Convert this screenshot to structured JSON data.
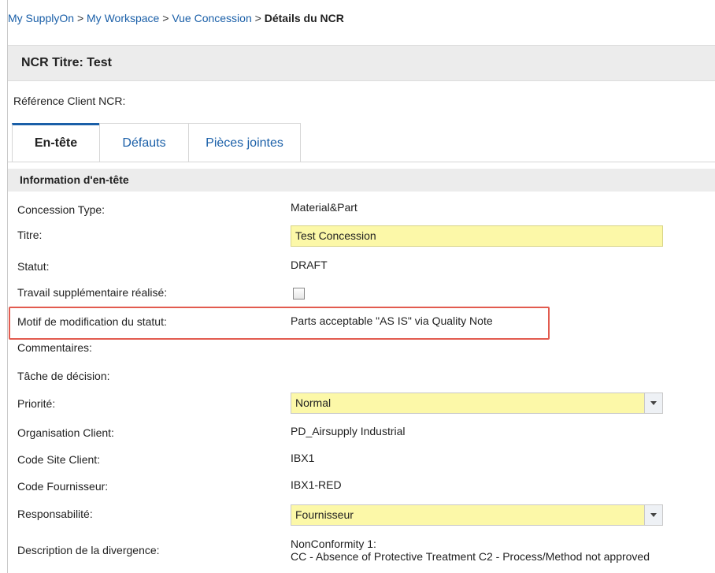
{
  "breadcrumb": {
    "items": [
      "My SupplyOn",
      "My Workspace",
      "Vue Concession"
    ],
    "separator": ">",
    "current": "Détails du NCR"
  },
  "ncr_title": "NCR Titre: Test",
  "reference_label": "Référence Client NCR:",
  "tabs": [
    {
      "label": "En-tête",
      "active": true
    },
    {
      "label": "Défauts",
      "active": false
    },
    {
      "label": "Pièces jointes",
      "active": false
    }
  ],
  "section_title": "Information d'en-tête",
  "fields": {
    "concession_type": {
      "label": "Concession Type:",
      "value": "Material&Part"
    },
    "titre": {
      "label": "Titre:",
      "value": "Test Concession"
    },
    "statut": {
      "label": "Statut:",
      "value": "DRAFT"
    },
    "travail": {
      "label": "Travail supplémentaire réalisé:",
      "checked": false
    },
    "motif": {
      "label": "Motif de modification du statut:",
      "value": "Parts acceptable \"AS IS\" via Quality Note"
    },
    "commentaires": {
      "label": "Commentaires:"
    },
    "tache": {
      "label": "Tâche de décision:"
    },
    "priorite": {
      "label": "Priorité:",
      "value": "Normal"
    },
    "organisation": {
      "label": "Organisation Client:",
      "value": "PD_Airsupply Industrial"
    },
    "code_site": {
      "label": "Code Site Client:",
      "value": "IBX1"
    },
    "code_fournisseur": {
      "label": "Code Fournisseur:",
      "value": "IBX1-RED"
    },
    "responsabilite": {
      "label": "Responsabilité:",
      "value": "Fournisseur"
    },
    "description": {
      "label": "Description de la divergence:",
      "line1": "NonConformity 1:",
      "line2": "CC - Absence of Protective Treatment C2 - Process/Method not approved"
    }
  },
  "colors": {
    "link": "#1a5fa8",
    "field_bg": "#fcf8a8",
    "highlight": "#e25b4f",
    "header_bg": "#ececec"
  },
  "icons": {
    "dropdown": "chevron-down-icon"
  }
}
